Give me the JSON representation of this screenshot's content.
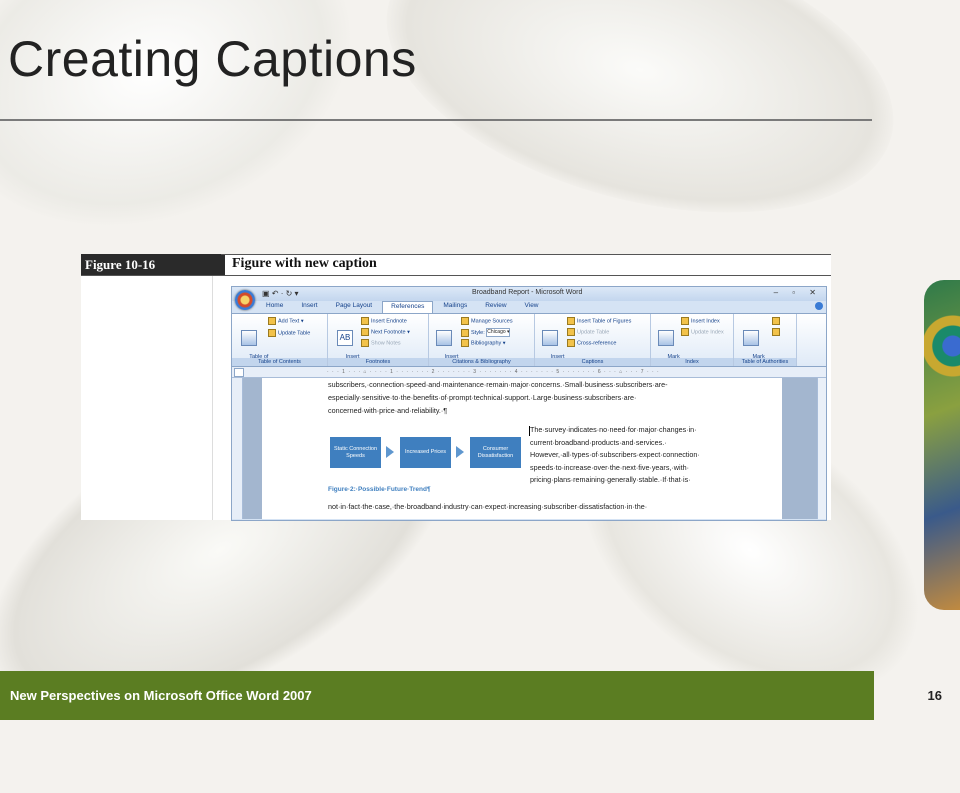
{
  "slide": {
    "title": "Creating Captions",
    "footer": "New Perspectives on Microsoft Office Word 2007",
    "page_number": "16"
  },
  "figure": {
    "label": "Figure 10-16",
    "caption": "Figure with new caption"
  },
  "word": {
    "quick_access": "▣ ↶ · ↻ ▾",
    "window_title": "Broadband Report - Microsoft Word",
    "window_controls": "– ▫ ✕",
    "tabs": [
      "Home",
      "Insert",
      "Page Layout",
      "References",
      "Mailings",
      "Review",
      "View"
    ],
    "active_tab": "References",
    "groups": {
      "toc": {
        "label": "Table of Contents",
        "big": "Table of\nContents ▾",
        "add_text": "Add Text ▾",
        "update_table": "Update Table"
      },
      "footnotes": {
        "label": "Footnotes",
        "big": "Insert\nFootnote",
        "insert_endnote": "Insert Endnote",
        "next_footnote": "Next Footnote ▾",
        "show_notes": "Show Notes"
      },
      "citations": {
        "label": "Citations & Bibliography",
        "big": "Insert\nCitation ▾",
        "manage_sources": "Manage Sources",
        "style_label": "Style:",
        "style_value": "Chicago ▾",
        "bibliography": "Bibliography ▾"
      },
      "captions": {
        "label": "Captions",
        "big": "Insert\nCaption",
        "insert_tof": "Insert Table of Figures",
        "update_table": "Update Table",
        "cross_reference": "Cross-reference"
      },
      "index": {
        "label": "Index",
        "big": "Mark\nEntry",
        "insert_index": "Insert Index",
        "update_index": "Update Index"
      },
      "toa": {
        "label": "Table of Authorities",
        "big": "Mark\nCitation"
      }
    },
    "ruler_text": "· · · 1 · · · ⌂ · · · · 1 · · · · · · · 2 · · · · · · · 3 · · · · · · · 4 · · · · · · · 5 · · · · · · · 6 · · · ⌂ · · · 7 · · ·",
    "document": {
      "para1_line1": "subscribers,·connection·speed·and·maintenance·remain·major·concerns.·Small·business·subscribers·are-",
      "para1_line2": "especially·sensitive·to·the·benefits·of·prompt·technical·support.·Large·business·subscribers·are·",
      "para1_line3": "concerned·with·price·and·reliability.·¶",
      "flow": [
        "Static Connection Speeds",
        "Increased Prices",
        "Consumer Dissatisfaction"
      ],
      "doc_caption": "Figure·2:·Possible·Future·Trend¶",
      "para2_line1": "The·survey·indicates·no·need·for·major·changes·in·",
      "para2_line2": "current·broadband·products·and·services.·",
      "para2_line3": "However,·all·types·of·subscribers·expect·connection·",
      "para2_line4": "speeds·to·increase·over·the·next·five·years,·with·",
      "para2_line5": "pricing·plans·remaining·generally·stable.·If·that·is·",
      "para3_line1": "not·in·fact·the·case,·the·broadband·industry·can·expect·increasing·subscriber·dissatisfaction·in·the·"
    }
  },
  "colors": {
    "footer_bar": "#5b7d22",
    "flow_box": "#3f7fbf",
    "caption_text": "#3f7fbf"
  }
}
